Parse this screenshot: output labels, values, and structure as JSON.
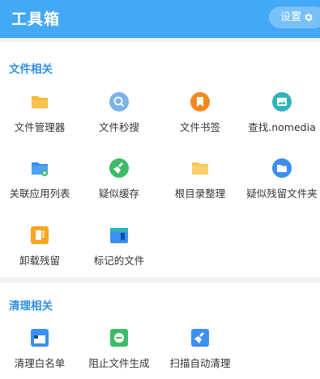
{
  "header": {
    "title": "工具箱",
    "settings_label": "设置"
  },
  "sections": [
    {
      "title": "文件相关",
      "items": [
        {
          "label": "文件管理器",
          "icon": "folder-icon"
        },
        {
          "label": "文件秒搜",
          "icon": "search-icon"
        },
        {
          "label": "文件书签",
          "icon": "bookmark-icon"
        },
        {
          "label": "查找.nomedia",
          "icon": "image-folder-icon"
        },
        {
          "label": "关联应用列表",
          "icon": "folder-add-icon"
        },
        {
          "label": "疑似缓存",
          "icon": "broom-icon"
        },
        {
          "label": "根目录整理",
          "icon": "folder-icon"
        },
        {
          "label": "疑似残留文件夹",
          "icon": "folder-badge-icon"
        },
        {
          "label": "卸载残留",
          "icon": "document-icon"
        },
        {
          "label": "标记的文件",
          "icon": "marked-file-icon"
        }
      ]
    },
    {
      "title": "清理相关",
      "items": [
        {
          "label": "清理白名单",
          "icon": "whitelist-icon"
        },
        {
          "label": "阻止文件生成",
          "icon": "block-icon"
        },
        {
          "label": "扫描自动清理",
          "icon": "auto-clean-icon"
        }
      ]
    }
  ],
  "colors": {
    "header_bg": "#43a8f5",
    "section_title": "#2f8fe3",
    "folder_orange": "#f7b538",
    "search_blue": "#7ab3e6",
    "bookmark_orange": "#f5891f",
    "teal": "#2fb4b9",
    "green": "#3dbb6a",
    "blue": "#3b8ff0"
  }
}
